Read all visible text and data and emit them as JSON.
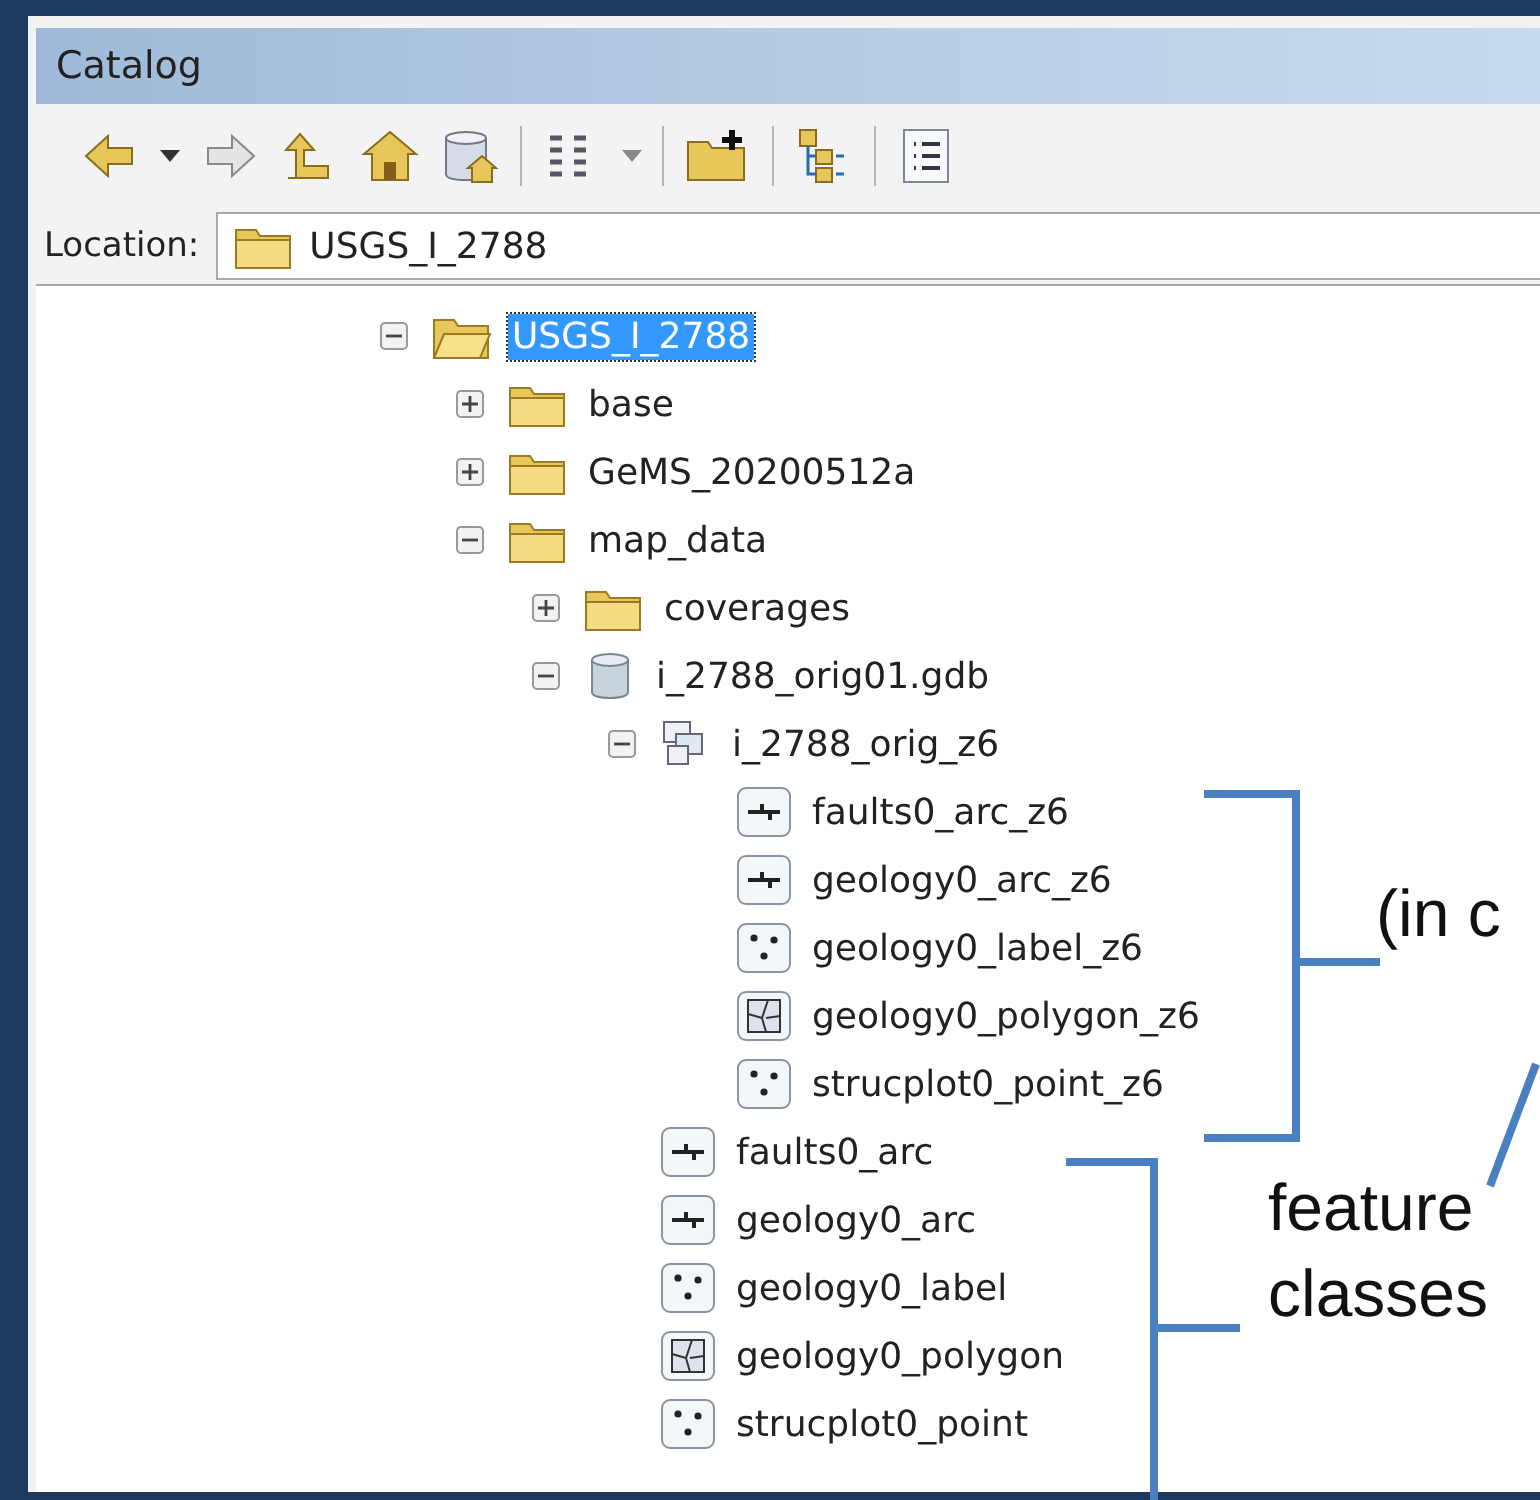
{
  "window": {
    "title": "Catalog"
  },
  "location": {
    "label": "Location:",
    "value": "USGS_I_2788"
  },
  "tree": [
    {
      "label": "USGS_I_2788",
      "kind": "folder-open",
      "expanded": true,
      "selected": true,
      "children": [
        {
          "label": "base",
          "kind": "folder",
          "expanded": false,
          "selected": false
        },
        {
          "label": "GeMS_20200512a",
          "kind": "folder",
          "expanded": false,
          "selected": false
        },
        {
          "label": "map_data",
          "kind": "folder",
          "expanded": true,
          "selected": false,
          "children": [
            {
              "label": "coverages",
              "kind": "folder",
              "expanded": false,
              "selected": false
            },
            {
              "label": "i_2788_orig01.gdb",
              "kind": "geodatabase",
              "expanded": true,
              "selected": false,
              "children": [
                {
                  "label": "i_2788_orig_z6",
                  "kind": "dataset",
                  "expanded": true,
                  "selected": false,
                  "children": [
                    {
                      "label": "faults0_arc_z6",
                      "kind": "line",
                      "selected": false
                    },
                    {
                      "label": "geology0_arc_z6",
                      "kind": "line",
                      "selected": false
                    },
                    {
                      "label": "geology0_label_z6",
                      "kind": "point",
                      "selected": false
                    },
                    {
                      "label": "geology0_polygon_z6",
                      "kind": "polygon",
                      "selected": false
                    },
                    {
                      "label": "strucplot0_point_z6",
                      "kind": "point",
                      "selected": false
                    }
                  ]
                },
                {
                  "label": "faults0_arc",
                  "kind": "line",
                  "selected": false
                },
                {
                  "label": "geology0_arc",
                  "kind": "line",
                  "selected": false
                },
                {
                  "label": "geology0_label",
                  "kind": "point",
                  "selected": false
                },
                {
                  "label": "geology0_polygon",
                  "kind": "polygon",
                  "selected": false
                },
                {
                  "label": "strucplot0_point",
                  "kind": "point",
                  "selected": false
                }
              ]
            }
          ]
        }
      ]
    }
  ],
  "annotations": {
    "note": "(in c",
    "caption": [
      "feature",
      "classes"
    ]
  }
}
